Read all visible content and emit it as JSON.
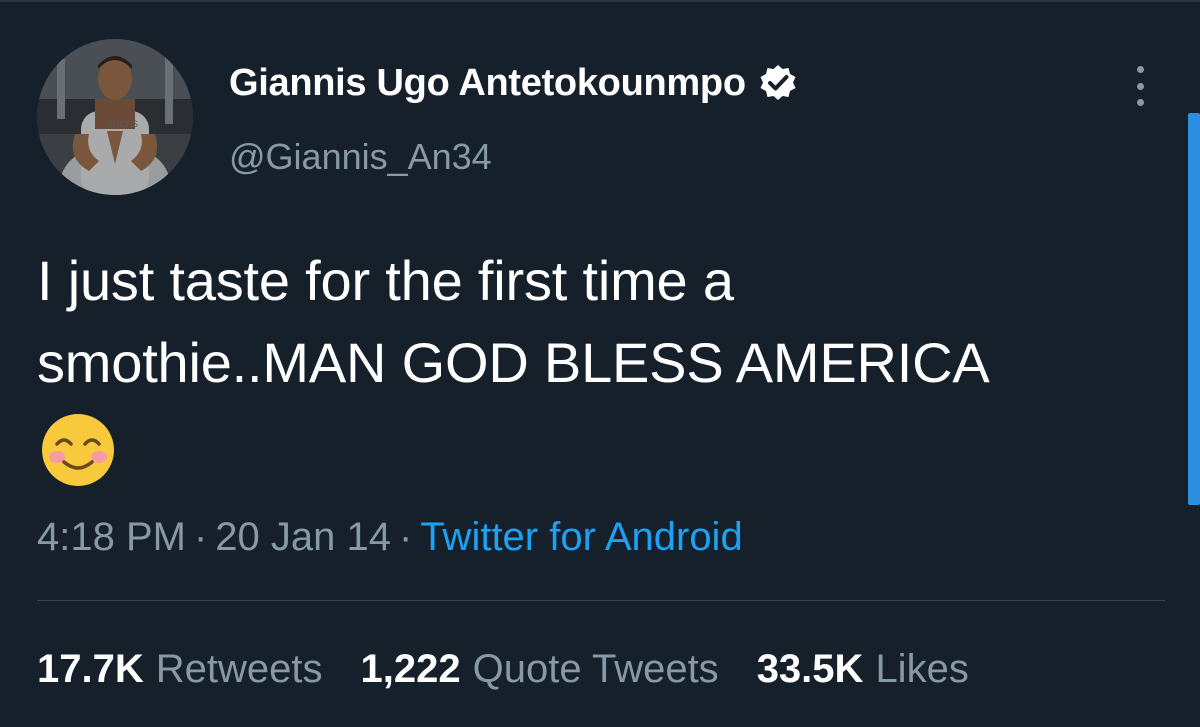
{
  "author": {
    "display_name": "Giannis Ugo Antetokounmpo",
    "handle": "@Giannis_An34",
    "verified": true,
    "avatar_icon": "profile-photo"
  },
  "tweet": {
    "text_lines": [
      "I just taste for the first time a",
      "smothie..MAN GOD BLESS AMERICA"
    ],
    "emoji": "smiling-face-with-smiling-eyes",
    "time": "4:18 PM",
    "date": "20 Jan 14",
    "separator": "·",
    "source": "Twitter for Android"
  },
  "stats": [
    {
      "count": "17.7K",
      "label": "Retweets"
    },
    {
      "count": "1,222",
      "label": "Quote Tweets"
    },
    {
      "count": "33.5K",
      "label": "Likes"
    }
  ],
  "colors": {
    "background": "#15202b",
    "text_primary": "#ffffff",
    "text_secondary": "#8899a6",
    "accent_link": "#1da1f2",
    "divider": "#38444d",
    "scrollbar": "#2d8fe0"
  }
}
